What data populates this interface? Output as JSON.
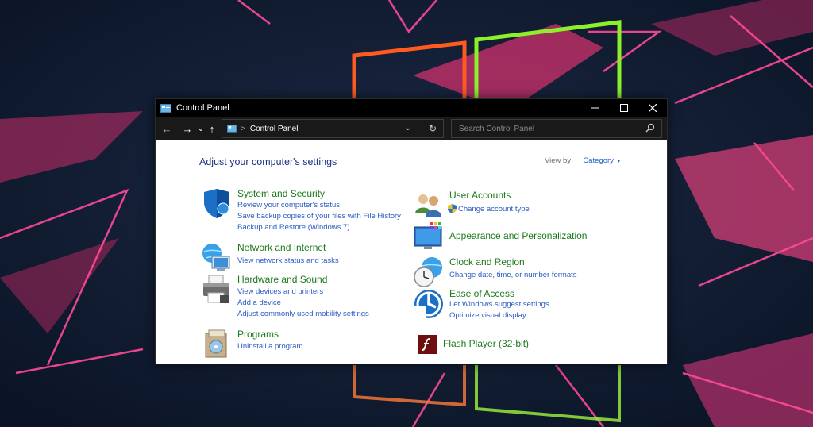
{
  "window": {
    "title": "Control Panel",
    "minimize": "—",
    "maximize": "☐",
    "close": "✕"
  },
  "nav": {
    "back": "←",
    "forward": "→",
    "recent": "⌄",
    "up": "↑",
    "address_path": "Control Panel",
    "address_sep": ">",
    "address_dropdown": "⌄",
    "refresh": "↻",
    "search_placeholder": "Search Control Panel"
  },
  "main": {
    "heading": "Adjust your computer's settings",
    "view_by_label": "View by:",
    "view_by_value": "Category",
    "view_by_arrow": "▾",
    "categories": [
      {
        "title": "System and Security",
        "links": [
          "Review your computer's status",
          "Save backup copies of your files with File History",
          "Backup and Restore (Windows 7)"
        ]
      },
      {
        "title": "Network and Internet",
        "links": [
          "View network status and tasks"
        ]
      },
      {
        "title": "Hardware and Sound",
        "links": [
          "View devices and printers",
          "Add a device",
          "Adjust commonly used mobility settings"
        ]
      },
      {
        "title": "Programs",
        "links": [
          "Uninstall a program"
        ]
      },
      {
        "title": "User Accounts",
        "links": [
          "Change account type"
        ]
      },
      {
        "title": "Appearance and Personalization",
        "links": []
      },
      {
        "title": "Clock and Region",
        "links": [
          "Change date, time, or number formats"
        ]
      },
      {
        "title": "Ease of Access",
        "links": [
          "Let Windows suggest settings",
          "Optimize visual display"
        ]
      },
      {
        "title": "Flash Player (32-bit)",
        "links": []
      }
    ]
  },
  "colors": {
    "title_green": "#1c7a1c",
    "link_blue": "#2a5bc4",
    "heading_blue": "#1e3287",
    "wallpaper_bg": "#0f1a2e",
    "neon_pink": "#ff3d8b",
    "neon_orange": "#ff5a1f",
    "neon_green": "#8cf02a"
  }
}
